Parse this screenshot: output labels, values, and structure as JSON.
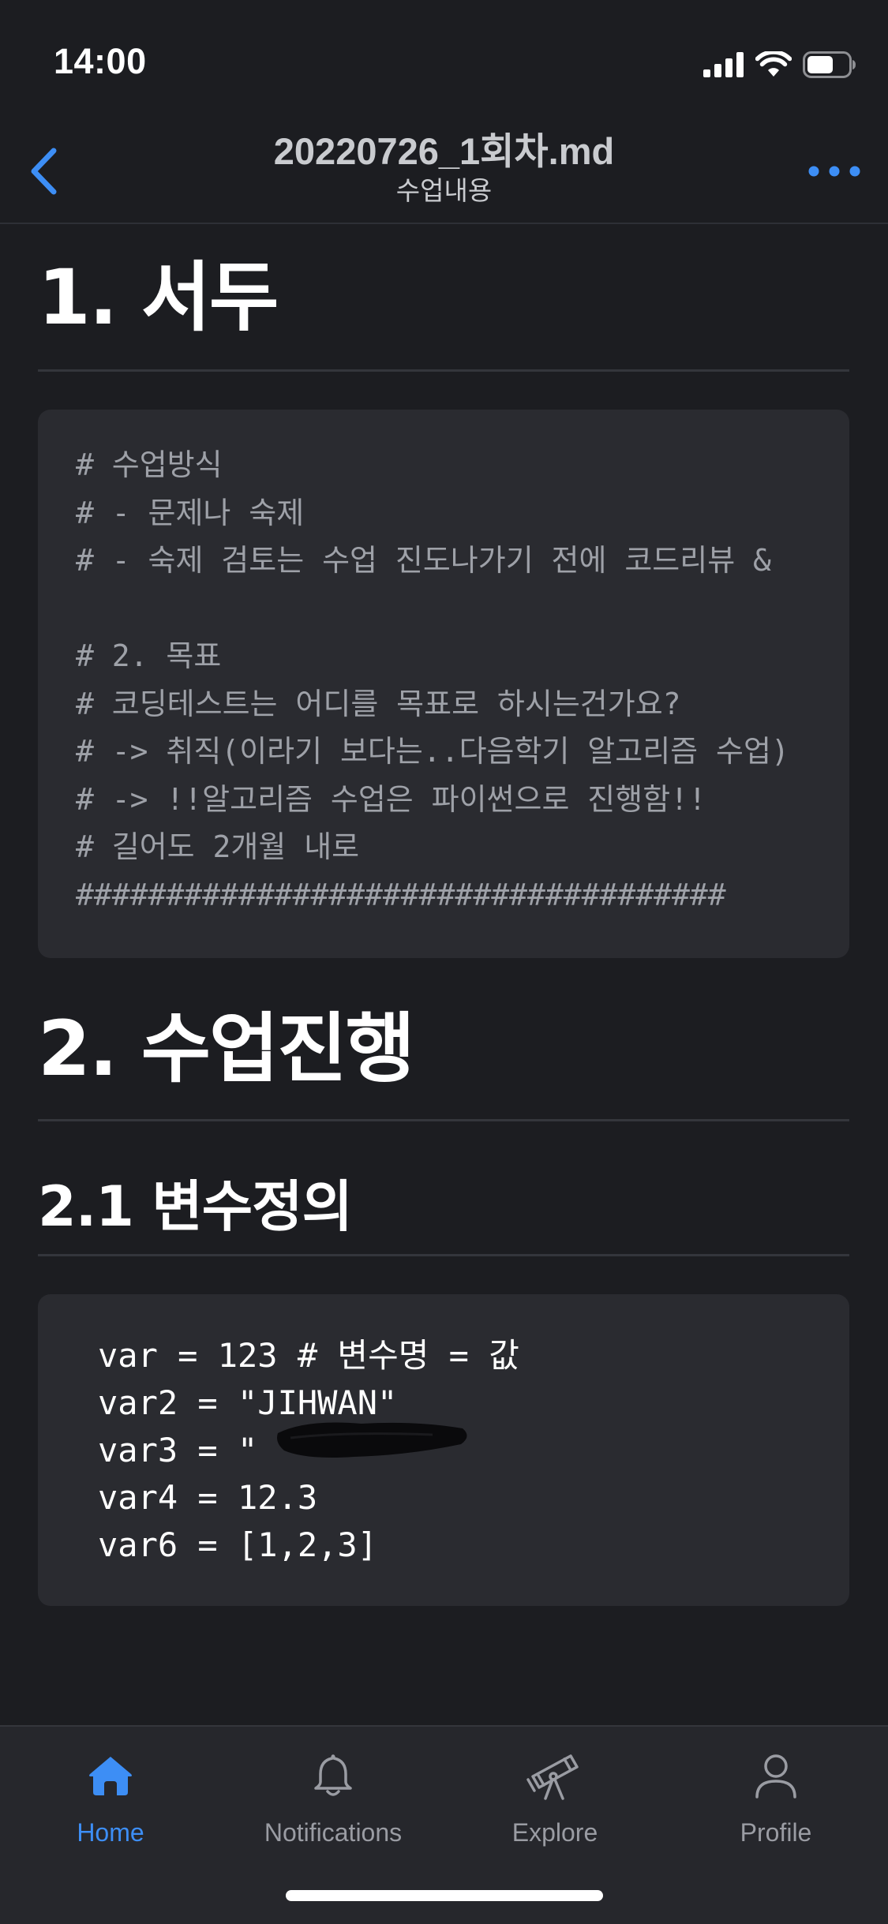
{
  "status_bar": {
    "time": "14:00"
  },
  "nav": {
    "title": "20220726_1회차.md",
    "subtitle": "수업내용"
  },
  "sections": [
    {
      "heading": "1. 서두",
      "code_lines": [
        "# 수업방식",
        "# - 문제나 숙제",
        "# - 숙제 검토는 수업 진도나가기 전에 코드리뷰 & ",
        "",
        "# 2. 목표",
        "# 코딩테스트는 어디를 목표로 하시는건가요?",
        "# -> 취직(이라기 보다는..다음학기 알고리즘 수업)",
        "# -> !!알고리즘 수업은 파이썬으로 진행함!!",
        "# 길어도 2개월 내로",
        "####################################"
      ]
    },
    {
      "heading": "2. 수업진행",
      "subsections": [
        {
          "heading": "2.1 변수정의",
          "code_lines": [
            "var = 123 # 변수명 = 값",
            "var2 = \"JIHWAN\"",
            "var3 = \"",
            "var4 = 12.3",
            "var6 = [1,2,3]"
          ]
        }
      ]
    }
  ],
  "tabs": [
    {
      "label": "Home",
      "icon": "home-icon",
      "active": true
    },
    {
      "label": "Notifications",
      "icon": "bell-icon",
      "active": false
    },
    {
      "label": "Explore",
      "icon": "telescope-icon",
      "active": false
    },
    {
      "label": "Profile",
      "icon": "person-icon",
      "active": false
    }
  ],
  "colors": {
    "background": "#1c1d21",
    "code_background": "#2a2b30",
    "accent": "#3d8ef5",
    "comment_text": "#9ea1a8",
    "inactive_tab": "#9a9ca3"
  }
}
